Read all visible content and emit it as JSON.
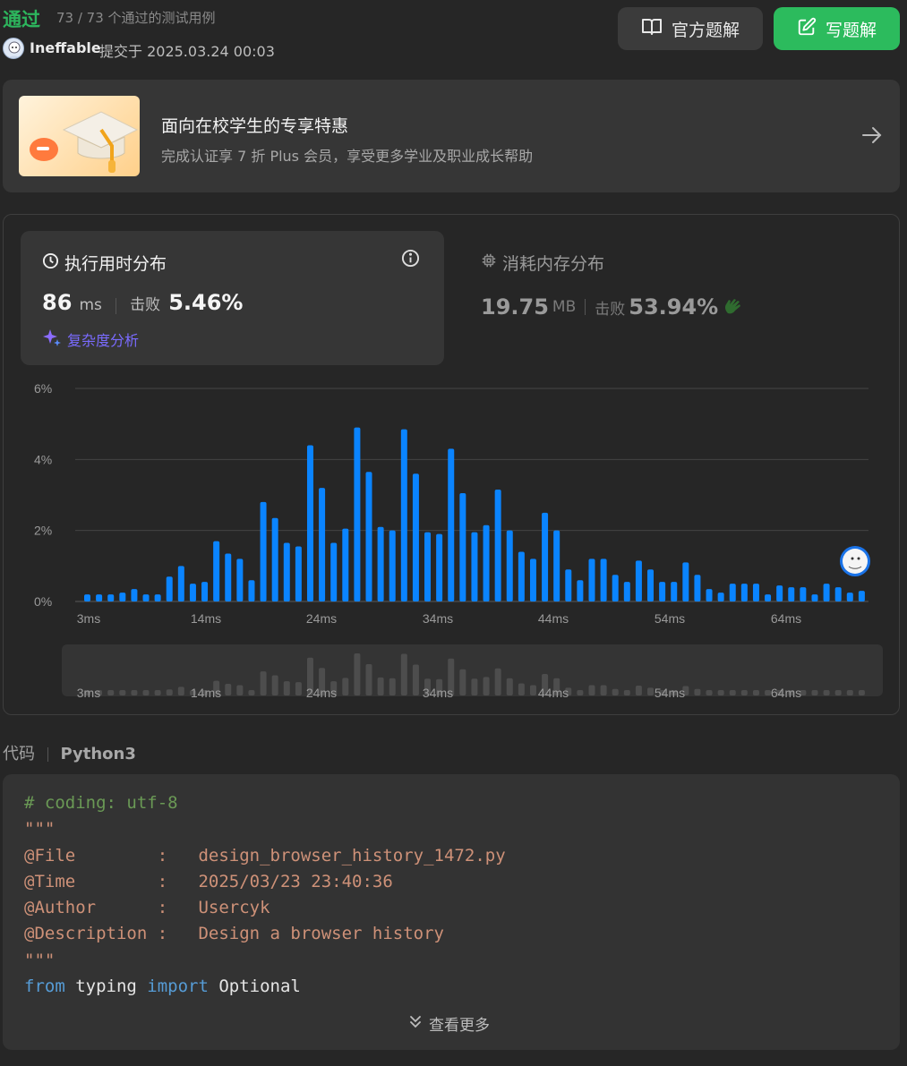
{
  "header": {
    "status": "通过",
    "passed": "73 / 73 个通过的测试用例",
    "user": "Ineffable",
    "submitted": "提交于 2025.03.24 00:03",
    "official_label": "官方题解",
    "write_label": "写题解"
  },
  "promo": {
    "title": "面向在校学生的专享特惠",
    "subtitle": "完成认证享 7 折 Plus 会员，享受更多学业及职业成长帮助"
  },
  "runtime": {
    "title": "执行用时分布",
    "value": "86",
    "unit": "ms",
    "beats_label": "击败",
    "beats": "5.46%",
    "analysis": "复杂度分析"
  },
  "memory": {
    "title": "消耗内存分布",
    "value": "19.75",
    "unit": "MB",
    "beats_label": "击败",
    "beats": "53.94%"
  },
  "colors": {
    "accent_green": "#2cbb5d",
    "bar_blue": "#0a84ff",
    "purple": "#7c5cff"
  },
  "chart_data": {
    "type": "bar",
    "ylabel": "",
    "xlabel": "",
    "ylim": [
      0,
      6
    ],
    "y_ticks": [
      "0%",
      "2%",
      "4%",
      "6%"
    ],
    "x_ticks": [
      "3ms",
      "14ms",
      "24ms",
      "34ms",
      "44ms",
      "54ms",
      "64ms"
    ],
    "values": [
      0.2,
      0.2,
      0.2,
      0.25,
      0.35,
      0.2,
      0.2,
      0.7,
      1.0,
      0.5,
      0.55,
      1.7,
      1.35,
      1.2,
      0.6,
      2.8,
      2.35,
      1.65,
      1.55,
      4.4,
      3.2,
      1.65,
      2.05,
      4.9,
      3.65,
      2.1,
      2.0,
      4.85,
      3.6,
      1.95,
      1.9,
      4.3,
      3.05,
      1.95,
      2.15,
      3.15,
      2.0,
      1.4,
      1.2,
      2.5,
      2.0,
      0.9,
      0.6,
      1.2,
      1.2,
      0.75,
      0.55,
      1.15,
      0.9,
      0.55,
      0.55,
      1.1,
      0.75,
      0.35,
      0.25,
      0.5,
      0.5,
      0.5,
      0.2,
      0.45,
      0.4,
      0.4,
      0.2,
      0.5,
      0.4,
      0.25,
      0.3
    ],
    "grid": true
  },
  "code": {
    "label": "代码",
    "language": "Python3",
    "lines": [
      {
        "parts": [
          {
            "t": "# coding: utf-8",
            "c": "cm"
          }
        ]
      },
      {
        "parts": [
          {
            "t": "\"\"\"",
            "c": "str"
          }
        ]
      },
      {
        "parts": [
          {
            "t": "@File        :   design_browser_history_1472.py",
            "c": "str"
          }
        ]
      },
      {
        "parts": [
          {
            "t": "@Time        :   2025/03/23 23:40:36",
            "c": "str"
          }
        ]
      },
      {
        "parts": [
          {
            "t": "@Author      :   Usercyk",
            "c": "str"
          }
        ]
      },
      {
        "parts": [
          {
            "t": "@Description :   Design a browser history",
            "c": "str"
          }
        ]
      },
      {
        "parts": [
          {
            "t": "\"\"\"",
            "c": "str"
          }
        ]
      },
      {
        "parts": [
          {
            "t": "from",
            "c": "kw"
          },
          {
            "t": " typing ",
            "c": "id"
          },
          {
            "t": "import",
            "c": "kw"
          },
          {
            "t": " Optional",
            "c": "id"
          }
        ]
      }
    ],
    "more_label": "查看更多"
  }
}
